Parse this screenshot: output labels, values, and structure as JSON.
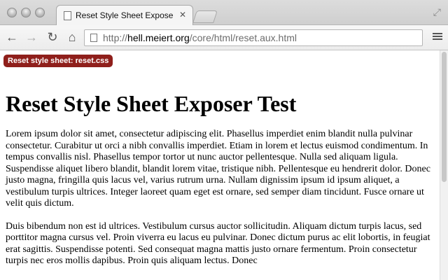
{
  "browser": {
    "tab_title": "Reset Style Sheet Exposer",
    "tab_close": "✕",
    "url_scheme": "http://",
    "url_host": "hell.meiert.org",
    "url_path": "/core/html/reset.aux.html",
    "icons": {
      "back": "←",
      "forward": "→",
      "reload": "↻",
      "home": "⌂",
      "restore": "⤢"
    }
  },
  "page": {
    "badge": "Reset style sheet: reset.css",
    "heading": "Reset Style Sheet Exposer Test",
    "paragraphs": [
      "Lorem ipsum dolor sit amet, consectetur adipiscing elit. Phasellus imperdiet enim blandit nulla pulvinar consectetur. Curabitur ut orci a nibh convallis imperdiet. Etiam in lorem et lectus euismod condimentum. In tempus convallis nisl. Phasellus tempor tortor ut nunc auctor pellentesque. Nulla sed aliquam ligula. Suspendisse aliquet libero blandit, blandit lorem vitae, tristique nibh. Pellentesque eu hendrerit dolor. Donec justo magna, fringilla quis lacus vel, varius rutrum urna. Nullam dignissim ipsum id ipsum aliquet, a vestibulum turpis ultrices. Integer laoreet quam eget est ornare, sed semper diam tincidunt. Fusce ornare ut velit quis dictum.",
      "Duis bibendum non est id ultrices. Vestibulum cursus auctor sollicitudin. Aliquam dictum turpis lacus, sed porttitor magna cursus vel. Proin viverra eu lacus eu pulvinar. Donec dictum purus ac elit lobortis, in feugiat erat sagittis. Suspendisse potenti. Sed consequat magna mattis justo ornare fermentum. Proin consectetur turpis nec eros mollis dapibus. Proin quis aliquam lectus. Donec"
    ]
  },
  "colors": {
    "badge_bg": "#8f1f1b",
    "badge_text": "#ffffff"
  }
}
